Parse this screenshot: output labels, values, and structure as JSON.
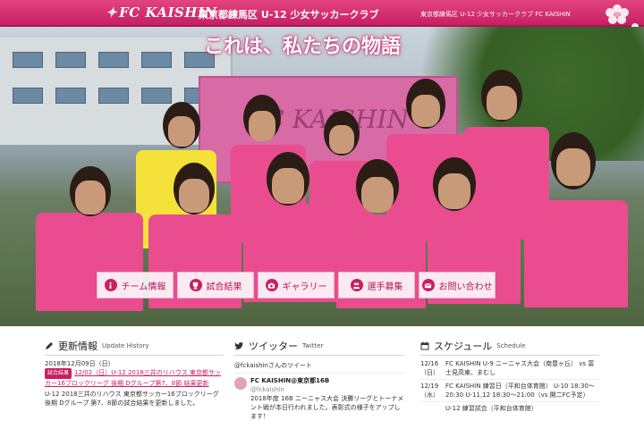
{
  "header": {
    "logo_text": "FC KAISHIN",
    "club_title": "東京都練馬区 U-12 少女サッカークラブ",
    "club_subtitle": "東京都練馬区 U-12 少女サッカークラブ FC KAISHIN"
  },
  "hero": {
    "headline": "これは、私たちの物語",
    "banner_text": "FC KAISHIN"
  },
  "nav": {
    "items": [
      {
        "label": "チーム情報",
        "icon": "info-icon"
      },
      {
        "label": "試合結果",
        "icon": "trophy-icon"
      },
      {
        "label": "ギャラリー",
        "icon": "camera-icon"
      },
      {
        "label": "選手募集",
        "icon": "people-icon"
      },
      {
        "label": "お問い合わせ",
        "icon": "mail-icon"
      }
    ]
  },
  "news": {
    "title": "更新情報",
    "title_en": "Update History",
    "date": "2018年12月09日（日）",
    "badge": "試合結果",
    "link_text": "12/02（日）U-12 2018三井のリハウス 東京都サッカー16ブロックリーグ 後期 Dグループ第7、8節 結果更新",
    "summary": "U-12 2018三井のリハウス 東京都サッカー16ブロックリーグ後期 Dグループ 第7、8節の試合結果を更新しました。"
  },
  "twitter": {
    "title": "ツイッター",
    "title_en": "Twitter",
    "handle_label": "@fckaishinさんのツイート",
    "account_name": "FC KAISHIN@東京都16B",
    "account_handle": "@fckaishin",
    "tweet_text": "2018年度 16B ニーニャス大会 決勝リーグとトーナメント戦が本日行われました。表彰式の様子をアップします！"
  },
  "schedule": {
    "title": "スケジュール",
    "title_en": "Schedule",
    "rows": [
      {
        "date": "12/16（日）",
        "text": "FC KAISHIN U-9 ニーニャス大会（南豊ヶ丘） vs 富士見高東、まむし",
        "highlight": true
      },
      {
        "date": "12/19（水）",
        "text": "FC KAISHIN 練習日（平和台体育館） U-10 18:30〜20:30 U-11,12 18:30〜21:00（vs 開二FC予定）",
        "highlight": false
      },
      {
        "date": "",
        "text": "U-12 練習試合（平和台体育館）",
        "highlight": false
      }
    ]
  },
  "colors": {
    "brand": "#c81f63",
    "brand_dark": "#a8154f"
  }
}
